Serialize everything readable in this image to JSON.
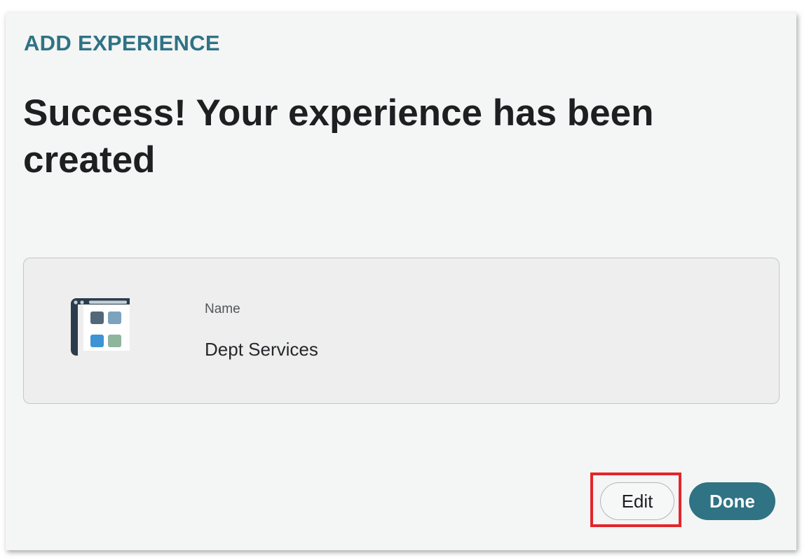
{
  "dialog": {
    "eyebrow": "ADD EXPERIENCE",
    "headline": "Success! Your experience has been created"
  },
  "card": {
    "icon": "web-app-layout-icon",
    "name_label": "Name",
    "name_value": "Dept Services"
  },
  "actions": {
    "edit_label": "Edit",
    "done_label": "Done"
  },
  "colors": {
    "accent": "#2f7384",
    "highlight": "#e3262b",
    "dialog_background": "#f4f5f5",
    "card_background": "#eeeeee"
  }
}
